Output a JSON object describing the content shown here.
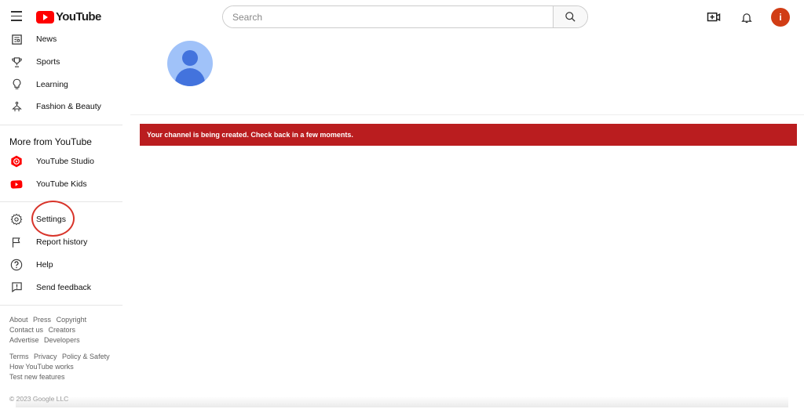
{
  "header": {
    "logo_text": "YouTube",
    "search_placeholder": "Search",
    "avatar_letter": "i"
  },
  "sidebar": {
    "explore_items": [
      {
        "label": "News",
        "icon": "news-icon"
      },
      {
        "label": "Sports",
        "icon": "trophy-icon"
      },
      {
        "label": "Learning",
        "icon": "lightbulb-icon"
      },
      {
        "label": "Fashion & Beauty",
        "icon": "hanger-icon"
      }
    ],
    "more_title": "More from YouTube",
    "more_items": [
      {
        "label": "YouTube Studio",
        "icon": "youtube-studio-icon"
      },
      {
        "label": "YouTube Kids",
        "icon": "youtube-kids-icon"
      }
    ],
    "settings_items": [
      {
        "label": "Settings",
        "icon": "gear-icon"
      },
      {
        "label": "Report history",
        "icon": "flag-icon"
      },
      {
        "label": "Help",
        "icon": "help-icon"
      },
      {
        "label": "Send feedback",
        "icon": "feedback-icon"
      }
    ],
    "footer_1": [
      "About",
      "Press",
      "Copyright",
      "Contact us",
      "Creators",
      "Advertise",
      "Developers"
    ],
    "footer_2": [
      "Terms",
      "Privacy",
      "Policy & Safety",
      "How YouTube works",
      "Test new features"
    ],
    "copyright": "© 2023 Google LLC"
  },
  "main": {
    "alert_text": "Your channel is being created. Check back in a few moments.",
    "alert_color": "#ba1d1f"
  }
}
